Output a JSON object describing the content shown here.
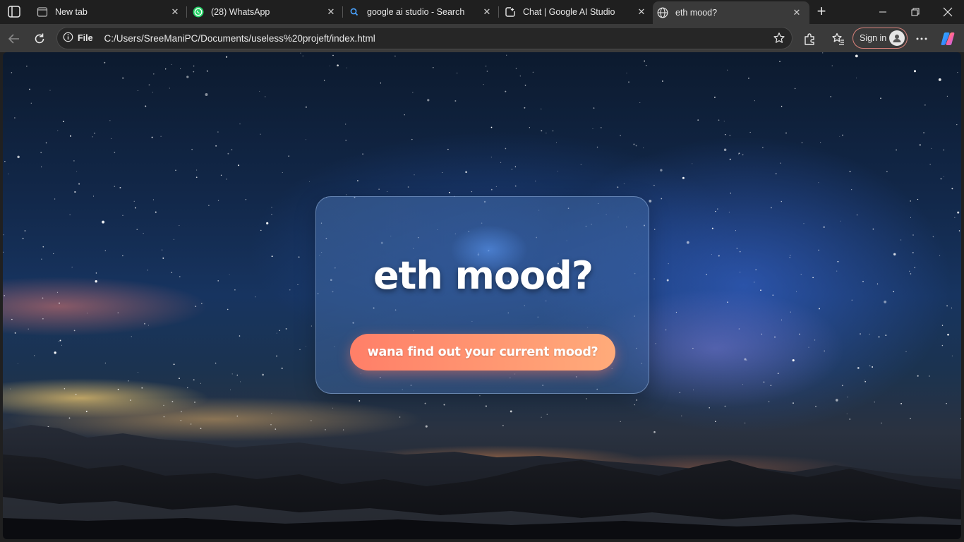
{
  "browser": {
    "tabs": [
      {
        "label": "New tab",
        "icon": "new-tab-page-icon"
      },
      {
        "label": "(28) WhatsApp",
        "icon": "whatsapp-icon"
      },
      {
        "label": "google ai studio - Search",
        "icon": "search-icon"
      },
      {
        "label": "Chat | Google AI Studio",
        "icon": "ai-studio-icon"
      },
      {
        "label": "eth mood?",
        "icon": "globe-icon",
        "active": true
      }
    ],
    "address": {
      "info_label": "File",
      "url": "C:/Users/SreeManiPC/Documents/useless%20projeft/index.html"
    },
    "signin_label": "Sign in"
  },
  "page": {
    "title": "eth mood?",
    "button_label": "wana find out your current mood?"
  },
  "colors": {
    "button_start": "#ff7f68",
    "button_end": "#ffab7a",
    "signin_border": "#d9827b"
  }
}
